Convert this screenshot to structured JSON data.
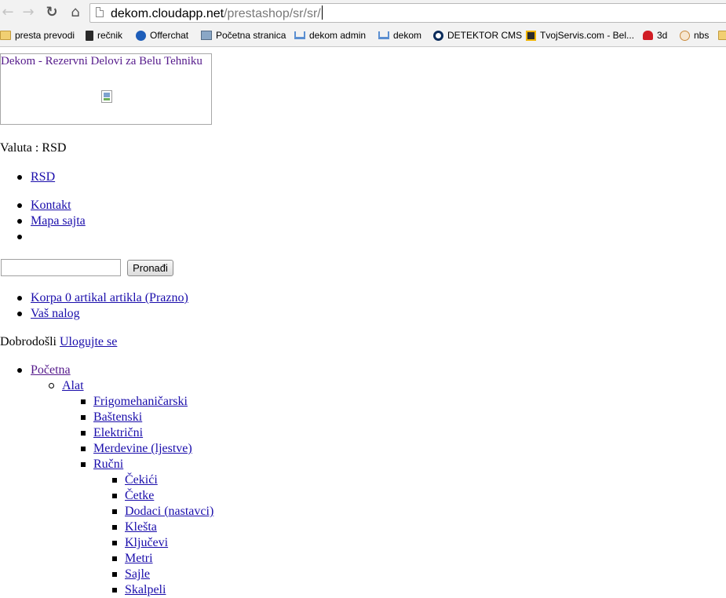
{
  "browser": {
    "url_host": "dekom.cloudapp.net",
    "url_path": "/prestashop/sr/sr/",
    "nav": {
      "back_icon": "arrow-left",
      "forward_icon": "arrow-right",
      "reload_icon": "reload",
      "home_icon": "home"
    },
    "bookmarks": [
      {
        "label": "presta prevodi",
        "icon": "folder-icon"
      },
      {
        "label": "rečnik",
        "icon": "book-icon"
      },
      {
        "label": "Offerchat",
        "icon": "person-icon"
      },
      {
        "label": "Početna stranica",
        "icon": "house-icon"
      },
      {
        "label": "dekom admin",
        "icon": "cart-icon"
      },
      {
        "label": "dekom",
        "icon": "cart-icon"
      },
      {
        "label": "DETEKTOR CMS",
        "icon": "ring-icon"
      },
      {
        "label": "TvojServis.com - Bel...",
        "icon": "x-logo-icon"
      },
      {
        "label": "3d",
        "icon": "heart-icon"
      },
      {
        "label": "nbs",
        "icon": "globe-icon"
      },
      {
        "label": "",
        "icon": "folder-icon"
      }
    ]
  },
  "page": {
    "logo_title": "Dekom - Rezervni Delovi za Belu Tehniku",
    "currency_label": "Valuta : RSD",
    "currency_options": [
      "RSD"
    ],
    "links": [
      "Kontakt",
      "Mapa sajta",
      ""
    ],
    "search": {
      "value": "",
      "button": "Pronađi"
    },
    "cart_links": [
      "Korpa 0 artikal artikla (Prazno)",
      "Vaš nalog"
    ],
    "welcome_text": "Dobrodošli",
    "login_link": "Ulogujte se",
    "categories": {
      "home": "Početna",
      "level1": "Alat",
      "level2": [
        "Frigomehaničarski",
        "Baštenski",
        "Električni",
        "Merdevine (ljestve)",
        "Ručni"
      ],
      "level3": [
        "Čekići",
        "Četke",
        "Dodaci (nastavci)",
        "Klešta",
        "Ključevi",
        "Metri",
        "Sajle",
        "Skalpeli"
      ]
    }
  }
}
